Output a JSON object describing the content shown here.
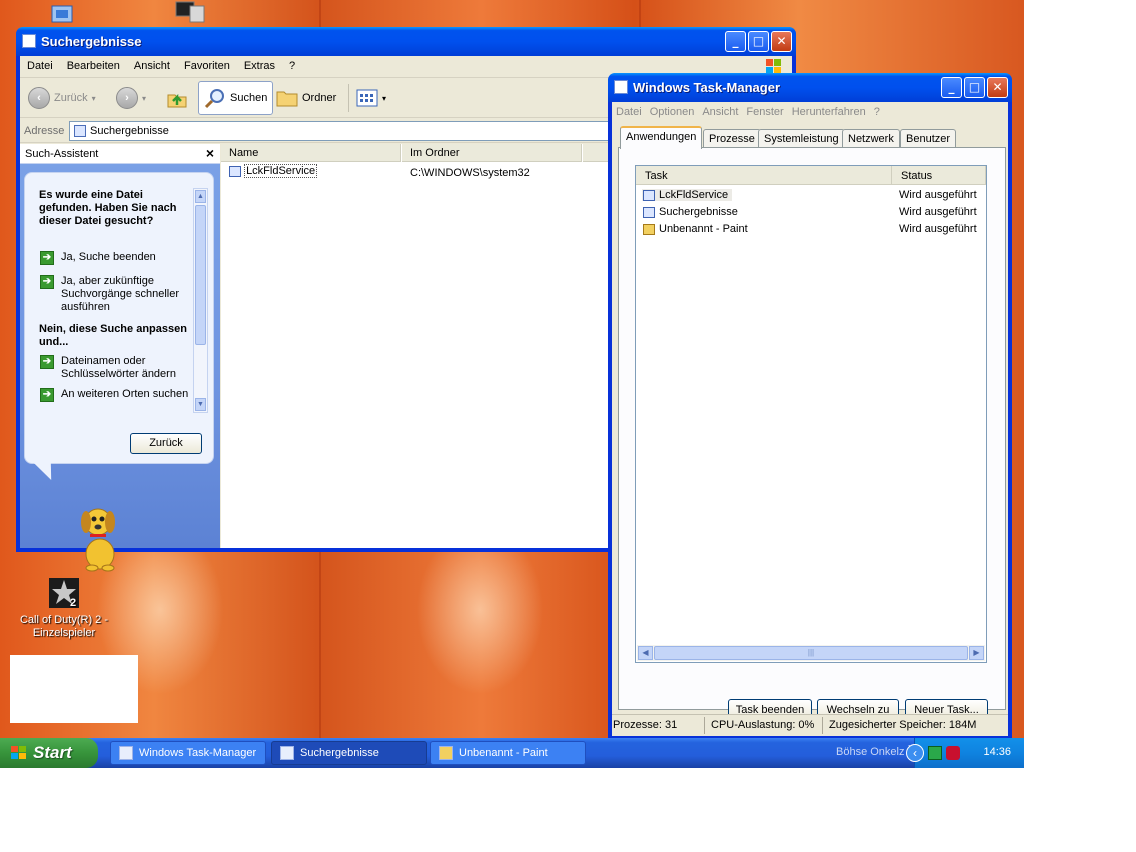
{
  "desktop": {
    "icons": [
      {
        "label": "Call of Duty(R) 2 - Einzelspieler"
      }
    ]
  },
  "search_window": {
    "title": "Suchergebnisse",
    "menu": [
      "Datei",
      "Bearbeiten",
      "Ansicht",
      "Favoriten",
      "Extras",
      "?"
    ],
    "toolbar": {
      "back": "Zurück",
      "search": "Suchen",
      "folders": "Ordner"
    },
    "address": {
      "label": "Adresse",
      "value": "Suchergebnisse"
    },
    "assistant": {
      "title": "Such-Assistent",
      "question1": "Es wurde eine Datei gefunden. Haben Sie nach dieser Datei gesucht?",
      "option1": "Ja, Suche beenden",
      "option2": "Ja, aber zukünftige Suchvorgänge schneller ausführen",
      "question2": "Nein, diese Suche anpassen und...",
      "option3": "Dateinamen oder Schlüsselwörter ändern",
      "option4": "An weiteren Orten suchen",
      "back_button": "Zurück"
    },
    "columns": {
      "name": "Name",
      "folder": "Im Ordner"
    },
    "results": [
      {
        "name": "LckFldService",
        "folder": "C:\\WINDOWS\\system32"
      }
    ]
  },
  "task_manager": {
    "title": "Windows Task-Manager",
    "menu": [
      "Datei",
      "Optionen",
      "Ansicht",
      "Fenster",
      "Herunterfahren",
      "?"
    ],
    "tabs": [
      "Anwendungen",
      "Prozesse",
      "Systemleistung",
      "Netzwerk",
      "Benutzer"
    ],
    "active_tab": "Anwendungen",
    "columns": {
      "task": "Task",
      "status": "Status"
    },
    "tasks": [
      {
        "name": "LckFldService",
        "status": "Wird ausgeführt"
      },
      {
        "name": "Suchergebnisse",
        "status": "Wird ausgeführt"
      },
      {
        "name": "Unbenannt - Paint",
        "status": "Wird ausgeführt"
      }
    ],
    "buttons": {
      "end_task": "Task beenden",
      "switch_to": "Wechseln zu",
      "new_task": "Neuer Task..."
    },
    "status": {
      "processes": "Prozesse: 31",
      "cpu": "CPU-Auslastung: 0%",
      "commit": "Zugesicherter Speicher: 184M"
    }
  },
  "taskbar": {
    "start": "Start",
    "buttons": [
      "Windows Task-Manager",
      "Suchergebnisse",
      "Unbenannt - Paint"
    ],
    "active_button": "Suchergebnisse",
    "toolbar_label": "Böhse Onkelz",
    "clock": "14:36"
  },
  "colors": {
    "titlebar": "#0053ee",
    "taskbar": "#245edb",
    "start_button": "#37943b",
    "tray": "#0f83e0"
  }
}
